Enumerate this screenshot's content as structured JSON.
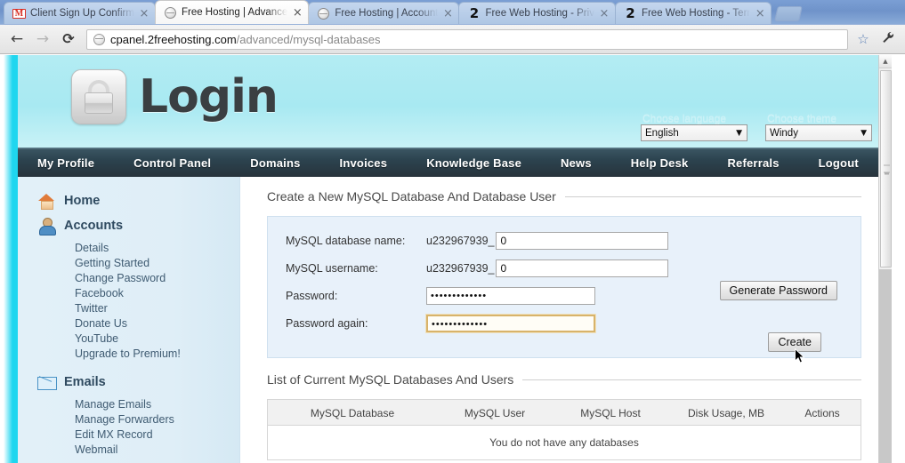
{
  "browser": {
    "tabs": [
      {
        "title": "Client Sign Up Confirm",
        "favicon": "gmail-icon",
        "active": false
      },
      {
        "title": "Free Hosting | Advance",
        "favicon": "globe-icon",
        "active": true
      },
      {
        "title": "Free Hosting | Account",
        "favicon": "globe-icon",
        "active": false
      },
      {
        "title": "Free Web Hosting - Priv",
        "favicon": "two-icon",
        "active": false
      },
      {
        "title": "Free Web Hosting - Terr",
        "favicon": "two-icon",
        "active": false
      }
    ],
    "nav": {
      "back": "←",
      "forward": "→",
      "reload": "⟳"
    },
    "omnibox": {
      "host": "cpanel.2freehosting.com",
      "path": "/advanced/mysql-databases",
      "icon": "globe-icon"
    },
    "star": "☆",
    "wrench": "🔧"
  },
  "site_header": {
    "logo_text": "Login",
    "logo_icon": "padlock-icon",
    "language": {
      "label": "Choose language",
      "value": "English",
      "arrow": "▼"
    },
    "theme": {
      "label": "Choose theme",
      "value": "Windy",
      "arrow": "▼"
    }
  },
  "navbar": {
    "items": [
      "My Profile",
      "Control Panel",
      "Domains",
      "Invoices",
      "Knowledge Base",
      "News",
      "Help Desk",
      "Referrals",
      "Logout"
    ]
  },
  "sidebar": {
    "groups": [
      {
        "label": "Home",
        "icon": "home-icon",
        "links": []
      },
      {
        "label": "Accounts",
        "icon": "user-icon",
        "links": [
          "Details",
          "Getting Started",
          "Change Password",
          "Facebook",
          "Twitter",
          "Donate Us",
          "YouTube",
          "Upgrade to Premium!"
        ]
      },
      {
        "label": "Emails",
        "icon": "mail-icon",
        "links": [
          "Manage Emails",
          "Manage Forwarders",
          "Edit MX Record",
          "Webmail"
        ]
      }
    ]
  },
  "main": {
    "create_section": {
      "title": "Create a New MySQL Database And Database User",
      "rows": [
        {
          "label": "MySQL database name:",
          "prefix": "u232967939_",
          "value": "0"
        },
        {
          "label": "MySQL username:",
          "prefix": "u232967939_",
          "value": "0"
        },
        {
          "label": "Password:",
          "value": "•••••••••••••"
        },
        {
          "label": "Password again:",
          "value": "•••••••••••••"
        }
      ],
      "generate_password_label": "Generate Password",
      "create_label": "Create"
    },
    "list_section": {
      "title": "List of Current MySQL Databases And Users",
      "columns": [
        "MySQL Database",
        "MySQL User",
        "MySQL Host",
        "Disk Usage, MB",
        "Actions"
      ],
      "empty_message": "You do not have any databases"
    }
  },
  "colors": {
    "page_accent": "#1fd6ef",
    "header_band": "#a8e9f2",
    "navbar": "#2c434f",
    "sidebar": "#dfeef7",
    "panel": "#e8f1fa",
    "focus_border": "#d8b36a"
  }
}
